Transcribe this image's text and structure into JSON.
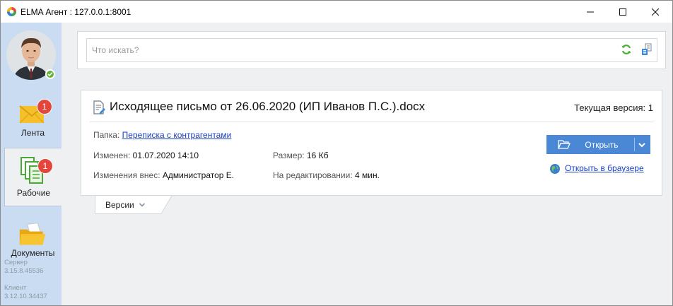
{
  "window": {
    "title": "ELMA Агент : 127.0.0.1:8001"
  },
  "sidebar": {
    "items": [
      {
        "label": "Лента",
        "badge": "1",
        "icon": "mail-icon"
      },
      {
        "label": "Рабочие",
        "badge": "1",
        "icon": "working-docs-icon"
      },
      {
        "label": "Документы",
        "icon": "documents-folder-icon"
      }
    ],
    "server_label": "Сервер",
    "server_version": "3.15.8.45536",
    "client_label": "Клиент",
    "client_version": "3.12.10.34437"
  },
  "search": {
    "placeholder": "Что искать?",
    "value": ""
  },
  "document": {
    "title": "Исходящее письмо от 26.06.2020 (ИП Иванов П.С.).docx",
    "current_version_label": "Текущая версия:",
    "current_version_value": "1",
    "folder_label": "Папка:",
    "folder_value": "Переписка с контрагентами",
    "modified_label": "Изменен:",
    "modified_value": "01.07.2020 14:10",
    "size_label": "Размер:",
    "size_value": "16 Кб",
    "changed_by_label": "Изменения внес:",
    "changed_by_value": "Администратор Е.",
    "editing_label": "На редактировании:",
    "editing_value": "4 мин.",
    "open_button": "Открыть",
    "open_browser_link": "Открыть в браузере"
  },
  "versions_tab": {
    "label": "Версии"
  },
  "colors": {
    "accent": "#4a88d6",
    "sidebar_bg": "#c9dcf1",
    "badge": "#e5463b",
    "online": "#5fb336",
    "link": "#1a3fc4"
  }
}
